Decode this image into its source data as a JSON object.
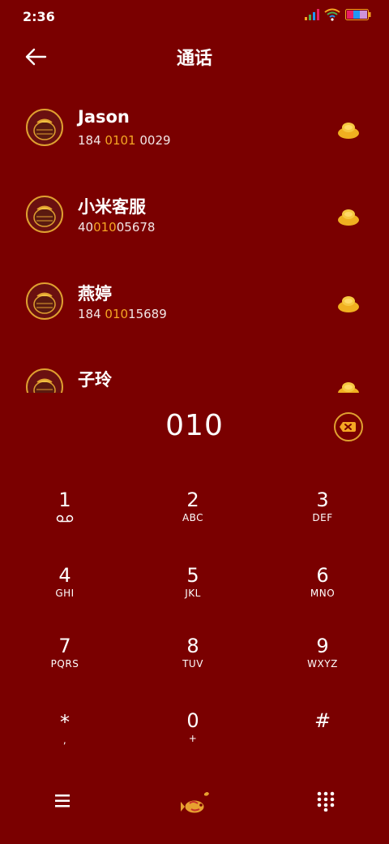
{
  "status": {
    "time": "2:36"
  },
  "header": {
    "title": "通话"
  },
  "contacts": [
    {
      "name": "Jason",
      "num_pre": "184 ",
      "num_hl": "0101",
      "num_post": " 0029"
    },
    {
      "name": "小米客服",
      "num_pre": "40",
      "num_hl": "010",
      "num_post": "05678"
    },
    {
      "name": "燕婷",
      "num_pre": "184 ",
      "num_hl": "010",
      "num_post": "15689"
    },
    {
      "name": "子玲",
      "num_pre": "",
      "num_hl": "",
      "num_post": ""
    }
  ],
  "dialer": {
    "input": "010",
    "keys": [
      {
        "digit": "1",
        "letters": ""
      },
      {
        "digit": "2",
        "letters": "ABC"
      },
      {
        "digit": "3",
        "letters": "DEF"
      },
      {
        "digit": "4",
        "letters": "GHI"
      },
      {
        "digit": "5",
        "letters": "JKL"
      },
      {
        "digit": "6",
        "letters": "MNO"
      },
      {
        "digit": "7",
        "letters": "PQRS"
      },
      {
        "digit": "8",
        "letters": "TUV"
      },
      {
        "digit": "9",
        "letters": "WXYZ"
      },
      {
        "digit": "*",
        "letters": ","
      },
      {
        "digit": "0",
        "letters": "+"
      },
      {
        "digit": "#",
        "letters": ""
      }
    ]
  },
  "colors": {
    "background": "#7a0000",
    "accent": "#f5a623",
    "gold": "#e0a030"
  },
  "icons": {
    "back": "back-arrow-icon",
    "delete": "backspace-icon",
    "menu": "menu-icon",
    "call": "koi-call-icon",
    "keypad": "dialpad-icon",
    "voicemail": "voicemail-icon"
  }
}
